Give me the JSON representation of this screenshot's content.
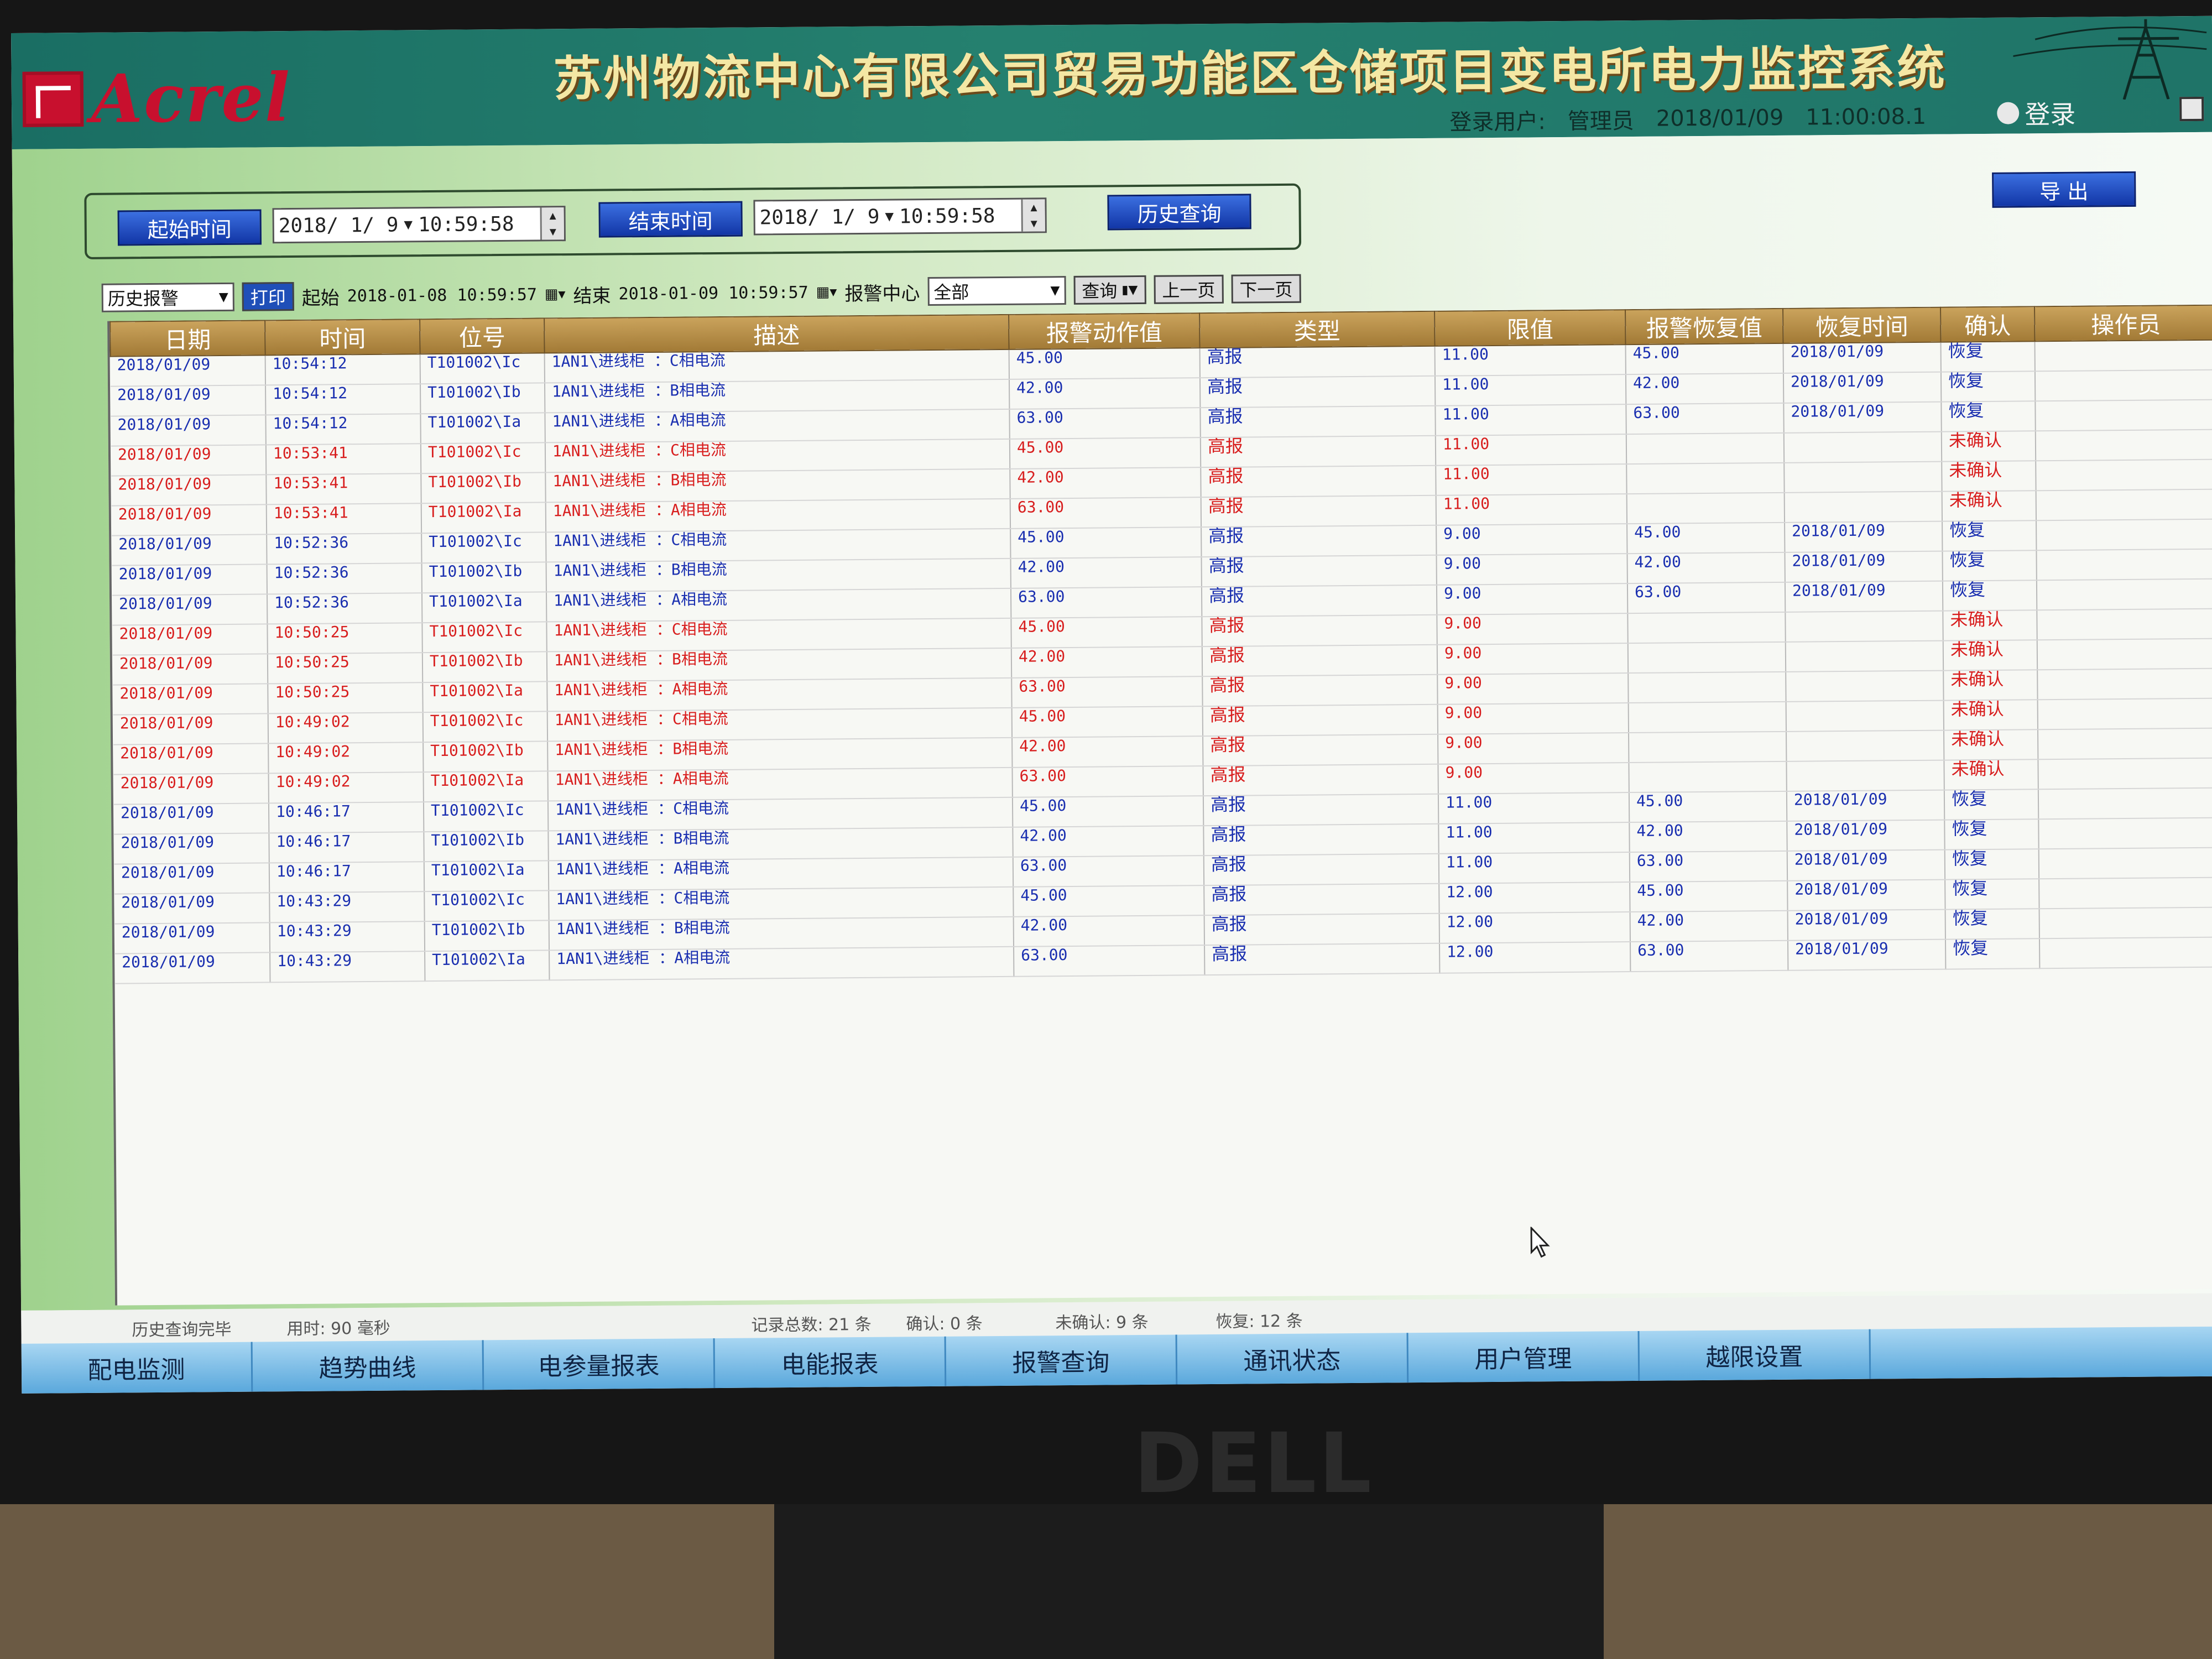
{
  "app": {
    "logo_text": "Acrel",
    "title": "苏州物流中心有限公司贸易功能区仓储项目变电所电力监控系统"
  },
  "userbar": {
    "user_label": "登录用户:",
    "user_name": "管理员",
    "date": "2018/01/09",
    "time": "11:00:08.1",
    "login_label": "登录"
  },
  "query": {
    "start_label": "起始时间",
    "start_date": "2018/ 1/ 9",
    "start_time": "10:59:58",
    "end_label": "结束时间",
    "end_date": "2018/ 1/ 9",
    "end_time": "10:59:58",
    "history_button": "历史查询",
    "export_button": "导 出"
  },
  "toolbar": {
    "mode_select": "历史报警",
    "print_button": "打印",
    "start_label": "起始",
    "start_value": "2018-01-08 10:59:57",
    "end_label": "结束",
    "end_value": "2018-01-09 10:59:57",
    "center_label": "报警中心",
    "center_select": "全部",
    "query_button": "查询",
    "prev_button": "上一页",
    "next_button": "下一页"
  },
  "table": {
    "columns": [
      "日期",
      "时间",
      "位号",
      "描述",
      "报警动作值",
      "类型",
      "限值",
      "报警恢复值",
      "恢复时间",
      "确认",
      "操作员"
    ],
    "rows": [
      {
        "status": "ok",
        "date": "2018/01/09",
        "time": "10:54:12",
        "tag": "T101002\\Ic",
        "desc": "1AN1\\进线柜 ：C相电流",
        "action": "45.00",
        "type": "高报",
        "limit": "11.00",
        "recover": "45.00",
        "rtime": "2018/01/09",
        "confirm": "恢复",
        "operator": ""
      },
      {
        "status": "ok",
        "date": "2018/01/09",
        "time": "10:54:12",
        "tag": "T101002\\Ib",
        "desc": "1AN1\\进线柜 ：B相电流",
        "action": "42.00",
        "type": "高报",
        "limit": "11.00",
        "recover": "42.00",
        "rtime": "2018/01/09",
        "confirm": "恢复",
        "operator": ""
      },
      {
        "status": "ok",
        "date": "2018/01/09",
        "time": "10:54:12",
        "tag": "T101002\\Ia",
        "desc": "1AN1\\进线柜 ：A相电流",
        "action": "63.00",
        "type": "高报",
        "limit": "11.00",
        "recover": "63.00",
        "rtime": "2018/01/09",
        "confirm": "恢复",
        "operator": ""
      },
      {
        "status": "un",
        "date": "2018/01/09",
        "time": "10:53:41",
        "tag": "T101002\\Ic",
        "desc": "1AN1\\进线柜 ：C相电流",
        "action": "45.00",
        "type": "高报",
        "limit": "11.00",
        "recover": "",
        "rtime": "",
        "confirm": "未确认",
        "operator": ""
      },
      {
        "status": "un",
        "date": "2018/01/09",
        "time": "10:53:41",
        "tag": "T101002\\Ib",
        "desc": "1AN1\\进线柜 ：B相电流",
        "action": "42.00",
        "type": "高报",
        "limit": "11.00",
        "recover": "",
        "rtime": "",
        "confirm": "未确认",
        "operator": ""
      },
      {
        "status": "un",
        "date": "2018/01/09",
        "time": "10:53:41",
        "tag": "T101002\\Ia",
        "desc": "1AN1\\进线柜 ：A相电流",
        "action": "63.00",
        "type": "高报",
        "limit": "11.00",
        "recover": "",
        "rtime": "",
        "confirm": "未确认",
        "operator": ""
      },
      {
        "status": "ok",
        "date": "2018/01/09",
        "time": "10:52:36",
        "tag": "T101002\\Ic",
        "desc": "1AN1\\进线柜 ：C相电流",
        "action": "45.00",
        "type": "高报",
        "limit": "9.00",
        "recover": "45.00",
        "rtime": "2018/01/09",
        "confirm": "恢复",
        "operator": ""
      },
      {
        "status": "ok",
        "date": "2018/01/09",
        "time": "10:52:36",
        "tag": "T101002\\Ib",
        "desc": "1AN1\\进线柜 ：B相电流",
        "action": "42.00",
        "type": "高报",
        "limit": "9.00",
        "recover": "42.00",
        "rtime": "2018/01/09",
        "confirm": "恢复",
        "operator": ""
      },
      {
        "status": "ok",
        "date": "2018/01/09",
        "time": "10:52:36",
        "tag": "T101002\\Ia",
        "desc": "1AN1\\进线柜 ：A相电流",
        "action": "63.00",
        "type": "高报",
        "limit": "9.00",
        "recover": "63.00",
        "rtime": "2018/01/09",
        "confirm": "恢复",
        "operator": ""
      },
      {
        "status": "un",
        "date": "2018/01/09",
        "time": "10:50:25",
        "tag": "T101002\\Ic",
        "desc": "1AN1\\进线柜 ：C相电流",
        "action": "45.00",
        "type": "高报",
        "limit": "9.00",
        "recover": "",
        "rtime": "",
        "confirm": "未确认",
        "operator": ""
      },
      {
        "status": "un",
        "date": "2018/01/09",
        "time": "10:50:25",
        "tag": "T101002\\Ib",
        "desc": "1AN1\\进线柜 ：B相电流",
        "action": "42.00",
        "type": "高报",
        "limit": "9.00",
        "recover": "",
        "rtime": "",
        "confirm": "未确认",
        "operator": ""
      },
      {
        "status": "un",
        "date": "2018/01/09",
        "time": "10:50:25",
        "tag": "T101002\\Ia",
        "desc": "1AN1\\进线柜 ：A相电流",
        "action": "63.00",
        "type": "高报",
        "limit": "9.00",
        "recover": "",
        "rtime": "",
        "confirm": "未确认",
        "operator": ""
      },
      {
        "status": "un",
        "date": "2018/01/09",
        "time": "10:49:02",
        "tag": "T101002\\Ic",
        "desc": "1AN1\\进线柜 ：C相电流",
        "action": "45.00",
        "type": "高报",
        "limit": "9.00",
        "recover": "",
        "rtime": "",
        "confirm": "未确认",
        "operator": ""
      },
      {
        "status": "un",
        "date": "2018/01/09",
        "time": "10:49:02",
        "tag": "T101002\\Ib",
        "desc": "1AN1\\进线柜 ：B相电流",
        "action": "42.00",
        "type": "高报",
        "limit": "9.00",
        "recover": "",
        "rtime": "",
        "confirm": "未确认",
        "operator": ""
      },
      {
        "status": "un",
        "date": "2018/01/09",
        "time": "10:49:02",
        "tag": "T101002\\Ia",
        "desc": "1AN1\\进线柜 ：A相电流",
        "action": "63.00",
        "type": "高报",
        "limit": "9.00",
        "recover": "",
        "rtime": "",
        "confirm": "未确认",
        "operator": ""
      },
      {
        "status": "ok",
        "date": "2018/01/09",
        "time": "10:46:17",
        "tag": "T101002\\Ic",
        "desc": "1AN1\\进线柜 ：C相电流",
        "action": "45.00",
        "type": "高报",
        "limit": "11.00",
        "recover": "45.00",
        "rtime": "2018/01/09",
        "confirm": "恢复",
        "operator": ""
      },
      {
        "status": "ok",
        "date": "2018/01/09",
        "time": "10:46:17",
        "tag": "T101002\\Ib",
        "desc": "1AN1\\进线柜 ：B相电流",
        "action": "42.00",
        "type": "高报",
        "limit": "11.00",
        "recover": "42.00",
        "rtime": "2018/01/09",
        "confirm": "恢复",
        "operator": ""
      },
      {
        "status": "ok",
        "date": "2018/01/09",
        "time": "10:46:17",
        "tag": "T101002\\Ia",
        "desc": "1AN1\\进线柜 ：A相电流",
        "action": "63.00",
        "type": "高报",
        "limit": "11.00",
        "recover": "63.00",
        "rtime": "2018/01/09",
        "confirm": "恢复",
        "operator": ""
      },
      {
        "status": "ok",
        "date": "2018/01/09",
        "time": "10:43:29",
        "tag": "T101002\\Ic",
        "desc": "1AN1\\进线柜 ：C相电流",
        "action": "45.00",
        "type": "高报",
        "limit": "12.00",
        "recover": "45.00",
        "rtime": "2018/01/09",
        "confirm": "恢复",
        "operator": ""
      },
      {
        "status": "ok",
        "date": "2018/01/09",
        "time": "10:43:29",
        "tag": "T101002\\Ib",
        "desc": "1AN1\\进线柜 ：B相电流",
        "action": "42.00",
        "type": "高报",
        "limit": "12.00",
        "recover": "42.00",
        "rtime": "2018/01/09",
        "confirm": "恢复",
        "operator": ""
      },
      {
        "status": "ok",
        "date": "2018/01/09",
        "time": "10:43:29",
        "tag": "T101002\\Ia",
        "desc": "1AN1\\进线柜 ：A相电流",
        "action": "63.00",
        "type": "高报",
        "limit": "12.00",
        "recover": "63.00",
        "rtime": "2018/01/09",
        "confirm": "恢复",
        "operator": ""
      }
    ]
  },
  "status": {
    "query_done": "历史查询完毕",
    "elapsed": "用时: 90 毫秒",
    "total": "记录总数: 21 条",
    "confirmed": "确认: 0 条",
    "unconfirmed": "未确认: 9 条",
    "recovered": "恢复: 12 条"
  },
  "nav": [
    "配电监测",
    "趋势曲线",
    "电参量报表",
    "电能报表",
    "报警查询",
    "通讯状态",
    "用户管理",
    "越限设置"
  ],
  "bezel": {
    "brand": "DELL"
  },
  "icons": {
    "logo": "acrel-logo-icon",
    "tower": "power-tower-icon",
    "person": "person-icon",
    "cursor": "mouse-cursor-icon"
  },
  "colors": {
    "confirmed_text": "#1a2fb0",
    "unconfirmed_text": "#d81e1e",
    "header_bg": "#1f7468",
    "title_gold": "#f4e7a4",
    "nav_bg": "#5aa8dc"
  }
}
